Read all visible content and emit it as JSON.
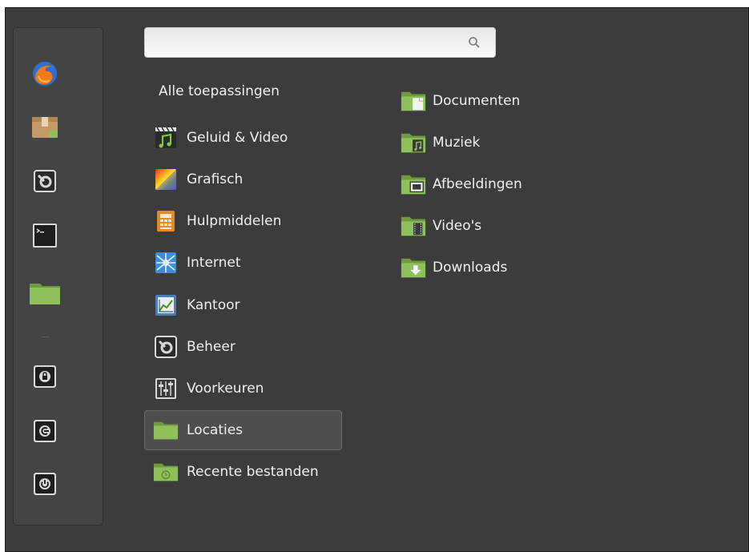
{
  "search": {
    "placeholder": "",
    "icon": "search-icon"
  },
  "favorites": [
    {
      "name": "firefox",
      "icon": "firefox-icon"
    },
    {
      "name": "package-installer",
      "icon": "package-icon"
    },
    {
      "name": "system-settings",
      "icon": "settings-icon"
    },
    {
      "name": "terminal",
      "icon": "terminal-icon"
    },
    {
      "name": "files",
      "icon": "folder-icon"
    }
  ],
  "session": [
    {
      "name": "lock-screen",
      "icon": "lock-icon"
    },
    {
      "name": "logout",
      "icon": "logout-icon"
    },
    {
      "name": "shutdown",
      "icon": "power-icon"
    }
  ],
  "all_apps_label": "Alle toepassingen",
  "categories": [
    {
      "label": "Geluid & Video",
      "icon": "sound-video-icon"
    },
    {
      "label": "Grafisch",
      "icon": "graphics-icon"
    },
    {
      "label": "Hulpmiddelen",
      "icon": "accessories-icon"
    },
    {
      "label": "Internet",
      "icon": "internet-icon"
    },
    {
      "label": "Kantoor",
      "icon": "office-icon"
    },
    {
      "label": "Beheer",
      "icon": "administration-icon"
    },
    {
      "label": "Voorkeuren",
      "icon": "preferences-icon"
    },
    {
      "label": "Locaties",
      "icon": "places-folder-icon",
      "selected": true
    },
    {
      "label": "Recente bestanden",
      "icon": "recent-files-icon"
    }
  ],
  "places": [
    {
      "label": "Documenten",
      "icon": "documents-folder-icon"
    },
    {
      "label": "Muziek",
      "icon": "music-folder-icon"
    },
    {
      "label": "Afbeeldingen",
      "icon": "pictures-folder-icon"
    },
    {
      "label": "Video's",
      "icon": "videos-folder-icon"
    },
    {
      "label": "Downloads",
      "icon": "downloads-folder-icon"
    }
  ],
  "colors": {
    "background": "#3c3c3c",
    "panel": "#444444",
    "folder_green": "#8fbf5a",
    "text": "#f0f0f0"
  }
}
